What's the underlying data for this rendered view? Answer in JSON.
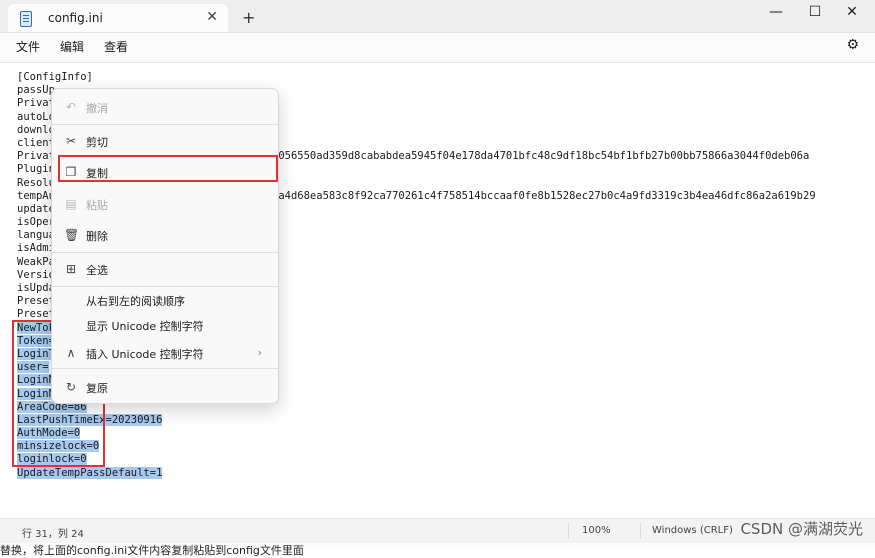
{
  "titlebar": {
    "tab_title": "config.ini",
    "close_glyph": "✕",
    "new_tab_glyph": "+",
    "minimize_glyph": "—",
    "maximize_glyph": "☐",
    "close_window_glyph": "✕"
  },
  "menubar": {
    "file": "文件",
    "edit": "编辑",
    "view": "查看",
    "settings_glyph": "⚙"
  },
  "editor": {
    "lines": [
      {
        "text": "[ConfigInfo]",
        "selected": false
      },
      {
        "text": "passUp",
        "selected": false
      },
      {
        "text": "Privat",
        "selected": false
      },
      {
        "text": "autoLo",
        "selected": false
      },
      {
        "text": "downlo",
        "selected": false
      },
      {
        "text": "client",
        "selected": false
      },
      {
        "text": "Privat",
        "selected": false,
        "tail": "a056550ad359d8cababdea5945f04e178da4701bfc48c9df18bc54bf1bfb27b00bb75866a3044f0deb06a"
      },
      {
        "text": "Plugin",
        "selected": false
      },
      {
        "text": "Resolu",
        "selected": false
      },
      {
        "text": "tempAu",
        "selected": false,
        "tail": "aa4d68ea583c8f92ca770261c4f758514bccaaf0fe8b1528ec27b0c4a9fd3319c3b4ea46dfc86a2a619b29"
      },
      {
        "text": "update",
        "selected": false
      },
      {
        "text": "isOper",
        "selected": false
      },
      {
        "text": "langua",
        "selected": false
      },
      {
        "text": "isAdmi",
        "selected": false
      },
      {
        "text": "WeakPa",
        "selected": false
      },
      {
        "text": "Versio",
        "selected": false
      },
      {
        "text": "isUpda",
        "selected": false
      },
      {
        "text": "Preset",
        "selected": false
      },
      {
        "text": "Preset",
        "selected": false
      },
      {
        "text": "NewTok",
        "selected": true
      },
      {
        "text": "Token=",
        "selected": true
      },
      {
        "text": "LoginT",
        "selected": true
      },
      {
        "text": "user=",
        "selected": true
      },
      {
        "text": "LoginN",
        "selected": true
      },
      {
        "text": "LoginN",
        "selected": true
      },
      {
        "text": "AreaCode=86",
        "selected": true
      },
      {
        "text": "LastPushTimeEx=20230916",
        "selected": true
      },
      {
        "text": "AuthMode=0",
        "selected": true
      },
      {
        "text": "minsizelock=0",
        "selected": true
      },
      {
        "text": "loginlock=0",
        "selected": true
      },
      {
        "text": "UpdateTempPassDefault=1",
        "selected": true
      }
    ]
  },
  "context_menu": {
    "undo": "撤消",
    "cut": "剪切",
    "copy": "复制",
    "paste": "粘贴",
    "delete": "删除",
    "select_all": "全选",
    "rtl": "从右到左的阅读顺序",
    "show_unicode": "显示 Unicode 控制字符",
    "insert_unicode": "插入 Unicode 控制字符",
    "reconvert": "复原",
    "submenu_glyph": "›"
  },
  "statusbar": {
    "position": "行 31，列 24",
    "zoom": "100%",
    "line_ending": "Windows (CRLF)",
    "watermark": "CSDN @满湖荧光"
  },
  "below_text": "替换，将上面的config.ini文件内容复制粘贴到config文件里面",
  "colors": {
    "selection": "#a6c9ef",
    "highlight_box": "#e03232"
  }
}
